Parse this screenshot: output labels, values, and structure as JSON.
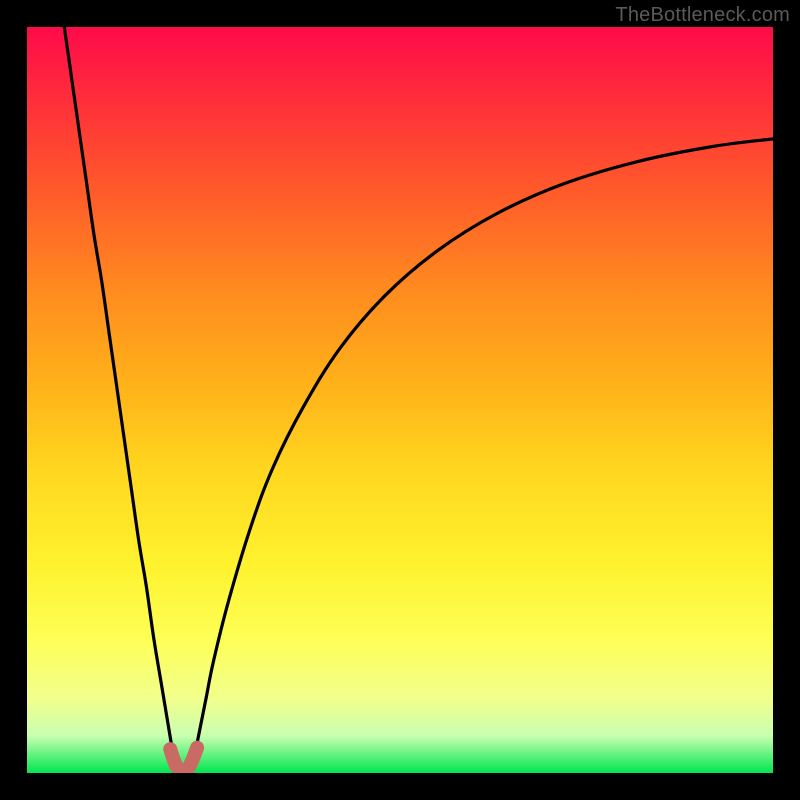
{
  "watermark": "TheBottleneck.com",
  "chart_data": {
    "type": "line",
    "title": "",
    "xlabel": "",
    "ylabel": "",
    "xlim": [
      0,
      100
    ],
    "ylim": [
      0,
      100
    ],
    "grid": false,
    "legend": false,
    "background_gradient": {
      "top": "#ff0a4a",
      "bottom": "#00e64f"
    },
    "series": [
      {
        "name": "left-branch",
        "x": [
          5,
          6,
          7,
          8,
          9,
          10,
          11,
          12,
          13,
          14,
          15,
          16,
          17,
          18,
          19,
          19.5,
          20
        ],
        "y": [
          100,
          93,
          86,
          79,
          72,
          66,
          59,
          52,
          45,
          38,
          31,
          25,
          18,
          12,
          6,
          3,
          0
        ],
        "color": "#000000"
      },
      {
        "name": "right-branch",
        "x": [
          22,
          23,
          24,
          25,
          27,
          30,
          33,
          37,
          42,
          48,
          55,
          63,
          72,
          82,
          92,
          100
        ],
        "y": [
          0,
          5,
          10,
          15,
          23,
          33,
          41,
          49,
          57,
          64,
          70,
          75,
          79,
          82,
          84,
          85
        ],
        "color": "#000000"
      },
      {
        "name": "valley-highlight",
        "x": [
          19.2,
          19.8,
          20.4,
          21.0,
          21.6,
          22.2,
          22.8
        ],
        "y": [
          3.2,
          1.4,
          0.4,
          0.2,
          0.6,
          1.8,
          3.4
        ],
        "color": "#c96a64"
      }
    ]
  }
}
